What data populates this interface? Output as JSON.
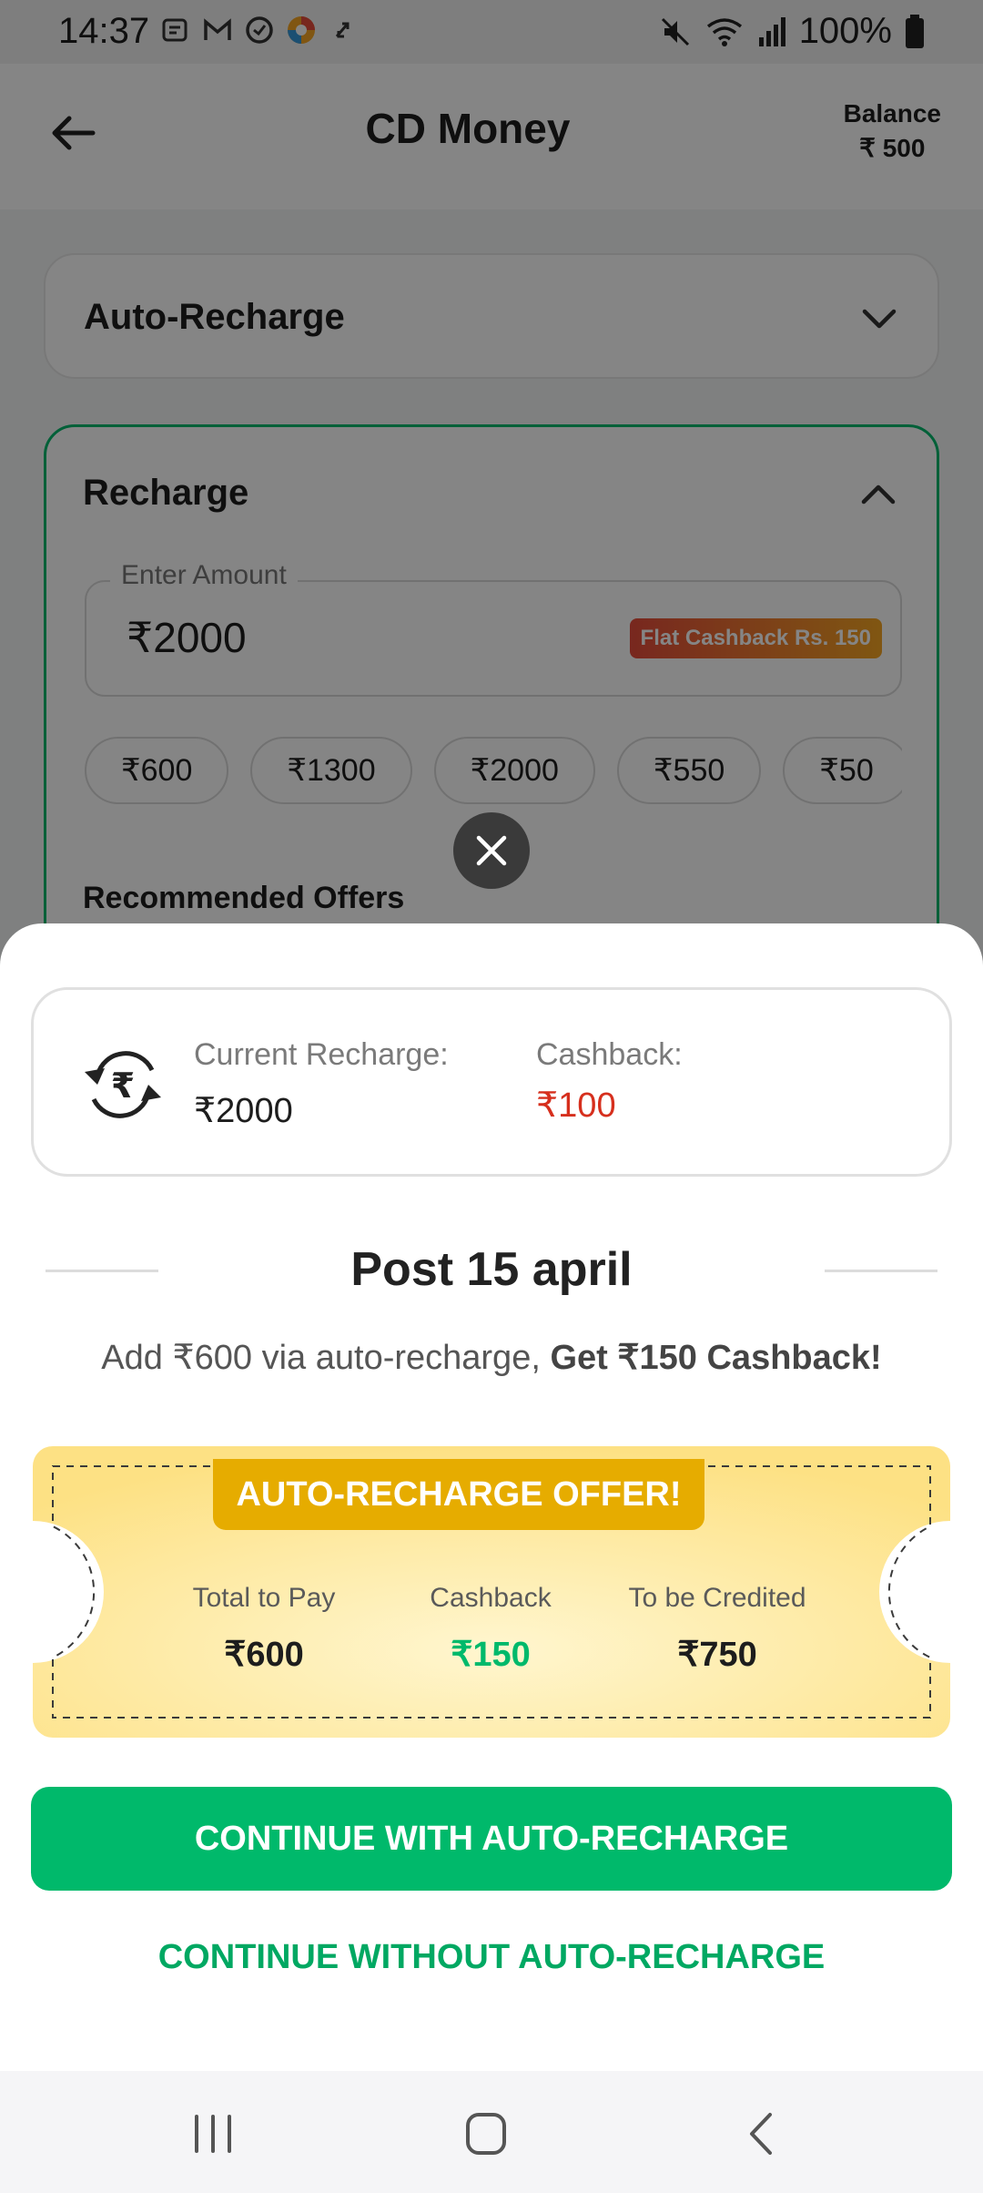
{
  "status_bar": {
    "time": "14:37",
    "battery": "100%",
    "left_icons": [
      "message-icon",
      "gmail-icon",
      "shield-icon",
      "app-icon",
      "sync-icon"
    ],
    "right_icons": [
      "mute-icon",
      "wifi-icon",
      "signal-icon",
      "battery-icon"
    ]
  },
  "app_bar": {
    "title": "CD Money",
    "balance_label": "Balance",
    "balance_value": "₹ 500"
  },
  "auto_recharge_section": {
    "label": "Auto-Recharge"
  },
  "recharge_section": {
    "label": "Recharge",
    "amount_legend": "Enter Amount",
    "amount_value": "₹2000",
    "cashback_badge": "Flat Cashback Rs. 150",
    "chips": [
      "₹600",
      "₹1300",
      "₹2000",
      "₹550",
      "₹50"
    ],
    "recommended_title": "Recommended Offers"
  },
  "sheet": {
    "current_recharge_label": "Current Recharge:",
    "current_recharge_value": "₹2000",
    "cashback_label": "Cashback:",
    "cashback_value": "₹100",
    "post_title": "Post 15 april",
    "offer_text_prefix": "Add ₹600 via auto-recharge, ",
    "offer_text_bold": "Get ₹150 Cashback!",
    "ticket": {
      "title": "AUTO-RECHARGE OFFER!",
      "columns": [
        {
          "label": "Total to Pay",
          "value": "₹600"
        },
        {
          "label": "Cashback",
          "value": "₹150"
        },
        {
          "label": "To be Credited",
          "value": "₹750"
        }
      ]
    },
    "primary_button": "CONTINUE WITH AUTO-RECHARGE",
    "secondary_button": "CONTINUE WITHOUT AUTO-RECHARGE"
  },
  "colors": {
    "accent_green": "#00b96b",
    "cashback_red": "#d62f1d",
    "ticket_gold": "#e6ac00"
  },
  "nav_bar": {
    "icons": [
      "recents-icon",
      "home-icon",
      "back-icon"
    ]
  }
}
